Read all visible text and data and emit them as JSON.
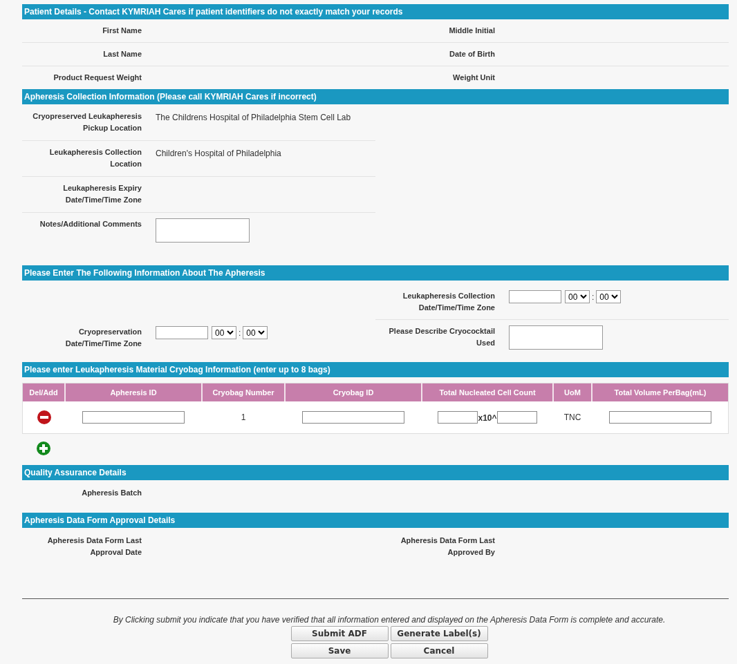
{
  "patient_details": {
    "title": "Patient Details - Contact KYMRIAH Cares if patient identifiers do not exactly match your records",
    "fields": [
      {
        "label": "First Name"
      },
      {
        "label": "Middle Initial"
      },
      {
        "label": "Last Name"
      },
      {
        "label": "Date of Birth"
      },
      {
        "label": "Product Request Weight"
      },
      {
        "label": "Weight Unit"
      }
    ]
  },
  "collection_info": {
    "title": "Apheresis Collection Information (Please call KYMRIAH Cares if incorrect)",
    "fields": [
      {
        "kind": "text",
        "label": "Cryopreserved Leukapheresis Pickup Location",
        "value": "The Childrens Hospital of Philadelphia Stem Cell Lab"
      },
      {
        "kind": "text",
        "label": "Leukapheresis Collection Location",
        "value": "Children's Hospital of Philadelphia"
      },
      {
        "kind": "text",
        "label": "Leukapheresis Expiry Date/Time/Time Zone"
      },
      {
        "kind": "textarea",
        "label": "Notes/Additional Comments"
      }
    ]
  },
  "apheresis_info": {
    "title": "Please Enter The Following Information About The Apheresis",
    "left": [
      {
        "kind": "datetime",
        "label": "Cryopreservation Date/Time/Time Zone",
        "hour": "00",
        "separator": ":",
        "minute": "00"
      }
    ],
    "right": [
      {
        "kind": "datetime",
        "label": "Leukapheresis Collection Date/Time/Time Zone",
        "hour": "00",
        "separator": ":",
        "minute": "00"
      },
      {
        "kind": "textarea",
        "label": "Please Describe Cryococktail Used"
      }
    ]
  },
  "cryobag": {
    "title": "Please enter Leukapheresis Material Cryobag Information (enter up to 8 bags)",
    "columns": [
      "Del/Add",
      "Apheresis ID",
      "Cryobag Number",
      "Cryobag ID",
      "Total Nucleated Cell Count",
      "UoM",
      "Total Volume PerBag(mL)"
    ],
    "rows": [
      {
        "cryobag_number": "1",
        "multiplier": "x10^",
        "uom": "TNC"
      }
    ]
  },
  "quality_assurance": {
    "title": "Quality Assurance Details",
    "fields": [
      {
        "label": "Apheresis Batch"
      }
    ]
  },
  "approval": {
    "title": "Apheresis Data Form Approval Details",
    "fields": [
      {
        "label": "Apheresis Data Form Last Approval Date"
      },
      {
        "label": "Apheresis Data Form Last Approved By"
      }
    ]
  },
  "notice": "By Clicking submit you indicate that you have verified that all information entered and displayed on the Apheresis Data Form is complete and accurate.",
  "buttons": [
    "Submit ADF",
    "Generate Label(s)",
    "Save",
    "Cancel"
  ]
}
